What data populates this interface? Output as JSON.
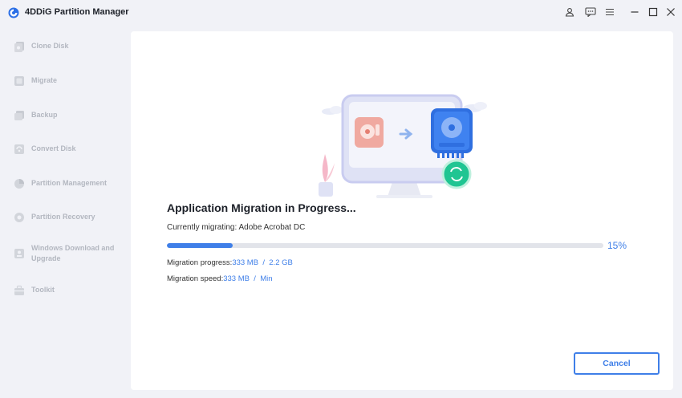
{
  "app": {
    "title": "4DDiG Partition Manager"
  },
  "titlebar": {
    "icons": [
      "user-icon",
      "feedback-icon",
      "menu-icon",
      "minimize-icon",
      "maximize-icon",
      "close-icon"
    ]
  },
  "sidebar": {
    "items": [
      {
        "label": "Clone Disk",
        "icon": "clone-disk-icon"
      },
      {
        "label": "Migrate",
        "icon": "migrate-icon"
      },
      {
        "label": "Backup",
        "icon": "backup-icon"
      },
      {
        "label": "Convert Disk",
        "icon": "convert-disk-icon"
      },
      {
        "label": "Partition Management",
        "icon": "partition-management-icon"
      },
      {
        "label": "Partition Recovery",
        "icon": "partition-recovery-icon"
      },
      {
        "label": "Windows Download and Upgrade",
        "icon": "windows-download-icon"
      },
      {
        "label": "Toolkit",
        "icon": "toolkit-icon"
      }
    ]
  },
  "main": {
    "heading": "Application Migration in Progress...",
    "current_label": "Currently migrating: ",
    "current_app": "Adobe Acrobat DC",
    "progress": {
      "percent": 15,
      "percent_text": "15%"
    },
    "migration_progress": {
      "label": "Migration progress:",
      "done": "333 MB",
      "separator": "  /  ",
      "total": "2.2 GB"
    },
    "migration_speed": {
      "label": "Migration speed:",
      "value": "333 MB",
      "separator": "  /  ",
      "unit": "Min"
    },
    "cancel_label": "Cancel"
  },
  "colors": {
    "accent": "#3f7fe8",
    "sidebar_text": "#b3b7c0",
    "background": "#f1f2f7"
  }
}
